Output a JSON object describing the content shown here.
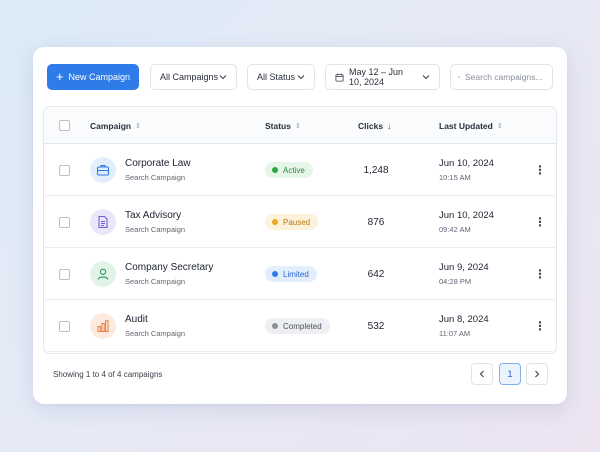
{
  "toolbar": {
    "new_campaign_label": "New Campaign",
    "campaign_filter": "All Campaigns",
    "status_filter": "All Status",
    "date_range": "May 12 – Jun 10, 2024",
    "search_placeholder": "Search campaigns..."
  },
  "table": {
    "headers": {
      "campaign": "Campaign",
      "status": "Status",
      "clicks": "Clicks",
      "last_updated": "Last Updated"
    },
    "rows": [
      {
        "name": "Corporate Law",
        "type": "Search Campaign",
        "status": "Active",
        "clicks": "1,248",
        "date": "Jun 10, 2024",
        "time": "10:15 AM",
        "icon": "briefcase-icon"
      },
      {
        "name": "Tax Advisory",
        "type": "Search Campaign",
        "status": "Paused",
        "clicks": "876",
        "date": "Jun 10, 2024",
        "time": "09:42 AM",
        "icon": "document-icon"
      },
      {
        "name": "Company Secretary",
        "type": "Search Campaign",
        "status": "Limited",
        "clicks": "642",
        "date": "Jun 9, 2024",
        "time": "04:28 PM",
        "icon": "user-icon"
      },
      {
        "name": "Audit",
        "type": "Search Campaign",
        "status": "Completed",
        "clicks": "532",
        "date": "Jun 8, 2024",
        "time": "11:07 AM",
        "icon": "bar-chart-icon"
      }
    ]
  },
  "footer": {
    "showing": "Showing 1 to 4 of 4 campaigns",
    "current_page": "1"
  },
  "colors": {
    "primary": "#2f7be8",
    "active": "#27a844",
    "paused": "#f0a91e",
    "limited": "#2f7be8",
    "completed": "#8a8f99"
  }
}
